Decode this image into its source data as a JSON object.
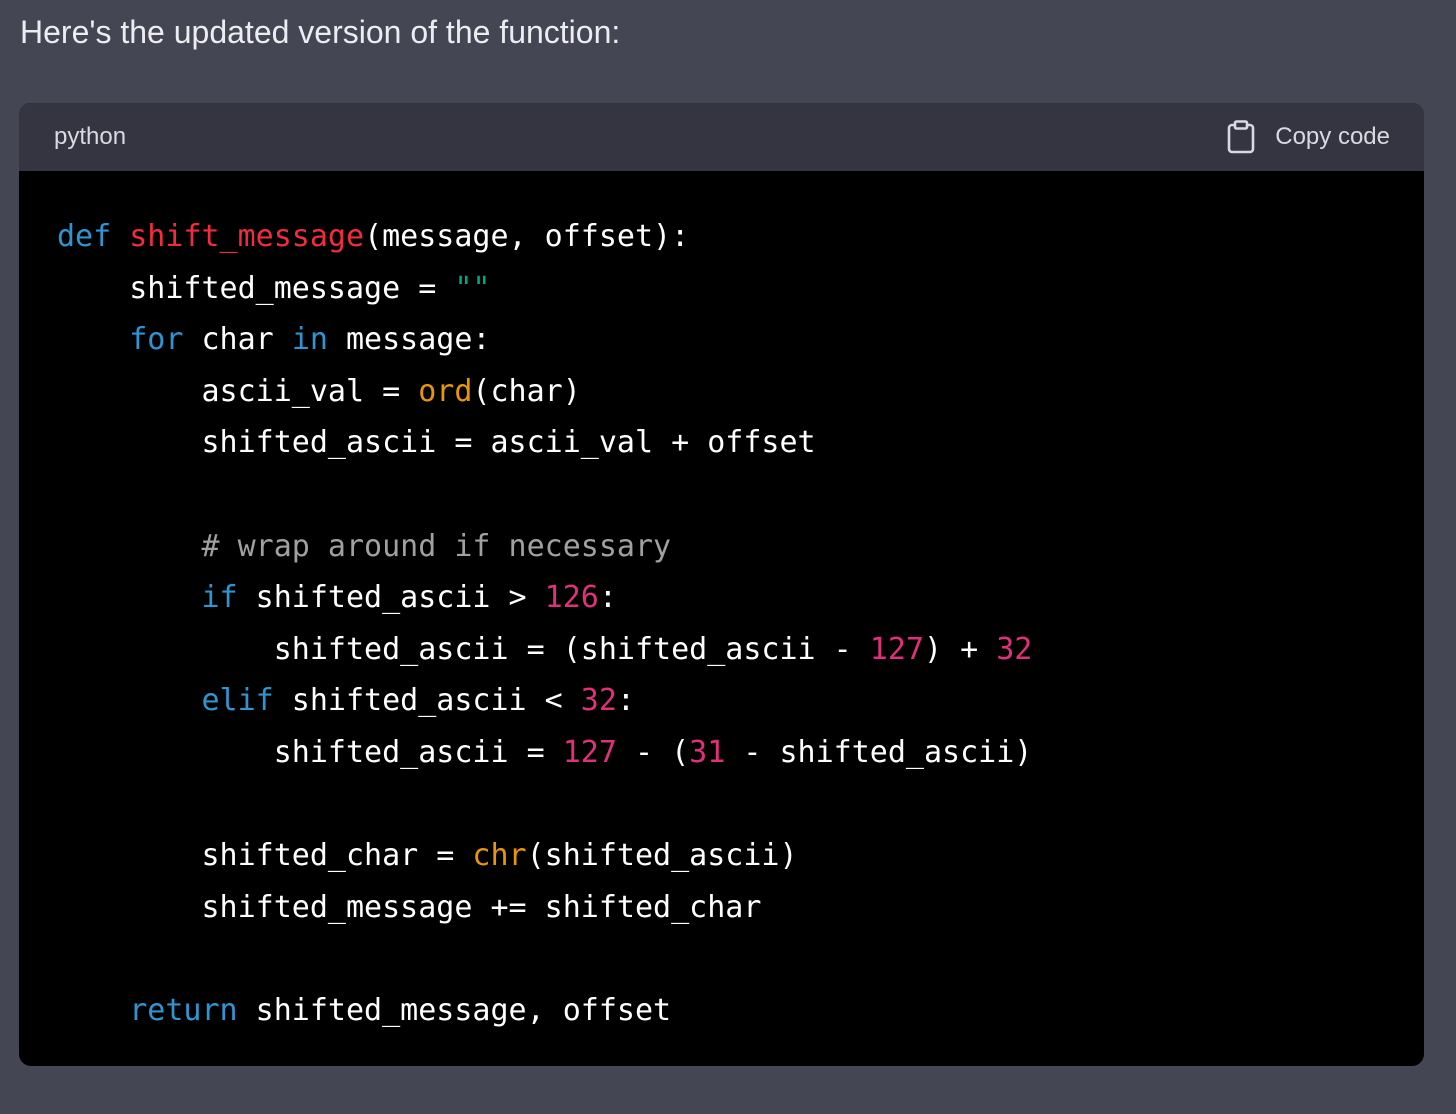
{
  "intro_text": "Here's the updated version of the function:",
  "code_block": {
    "language": "python",
    "copy_label": "Copy code",
    "copy_icon": "clipboard-icon",
    "colors": {
      "keyword": "#2e95d3",
      "function_name": "#f22c3d",
      "builtin": "#e9950c",
      "number": "#df3079",
      "string": "#00a67d",
      "comment": "#a0a0a0",
      "plain": "#ffffff"
    },
    "lines": [
      [
        [
          "kw",
          "def"
        ],
        [
          "t",
          " "
        ],
        [
          "fn",
          "shift_message"
        ],
        [
          "t",
          "(message, offset):"
        ]
      ],
      [
        [
          "t",
          "    shifted_message = "
        ],
        [
          "str",
          "\"\""
        ]
      ],
      [
        [
          "t",
          "    "
        ],
        [
          "kw",
          "for"
        ],
        [
          "t",
          " char "
        ],
        [
          "kw",
          "in"
        ],
        [
          "t",
          " message:"
        ]
      ],
      [
        [
          "t",
          "        ascii_val = "
        ],
        [
          "bi",
          "ord"
        ],
        [
          "t",
          "(char)"
        ]
      ],
      [
        [
          "t",
          "        shifted_ascii = ascii_val + offset"
        ]
      ],
      [],
      [
        [
          "cm",
          "        # wrap around if necessary"
        ]
      ],
      [
        [
          "t",
          "        "
        ],
        [
          "kw",
          "if"
        ],
        [
          "t",
          " shifted_ascii > "
        ],
        [
          "num",
          "126"
        ],
        [
          "t",
          ":"
        ]
      ],
      [
        [
          "t",
          "            shifted_ascii = (shifted_ascii - "
        ],
        [
          "num",
          "127"
        ],
        [
          "t",
          ") + "
        ],
        [
          "num",
          "32"
        ]
      ],
      [
        [
          "t",
          "        "
        ],
        [
          "kw",
          "elif"
        ],
        [
          "t",
          " shifted_ascii < "
        ],
        [
          "num",
          "32"
        ],
        [
          "t",
          ":"
        ]
      ],
      [
        [
          "t",
          "            shifted_ascii = "
        ],
        [
          "num",
          "127"
        ],
        [
          "t",
          " - ("
        ],
        [
          "num",
          "31"
        ],
        [
          "t",
          " - shifted_ascii)"
        ]
      ],
      [],
      [
        [
          "t",
          "        shifted_char = "
        ],
        [
          "bi",
          "chr"
        ],
        [
          "t",
          "(shifted_ascii)"
        ]
      ],
      [
        [
          "t",
          "        shifted_message += shifted_char"
        ]
      ],
      [],
      [
        [
          "t",
          "    "
        ],
        [
          "kw",
          "return"
        ],
        [
          "t",
          " shifted_message, offset"
        ]
      ]
    ]
  }
}
